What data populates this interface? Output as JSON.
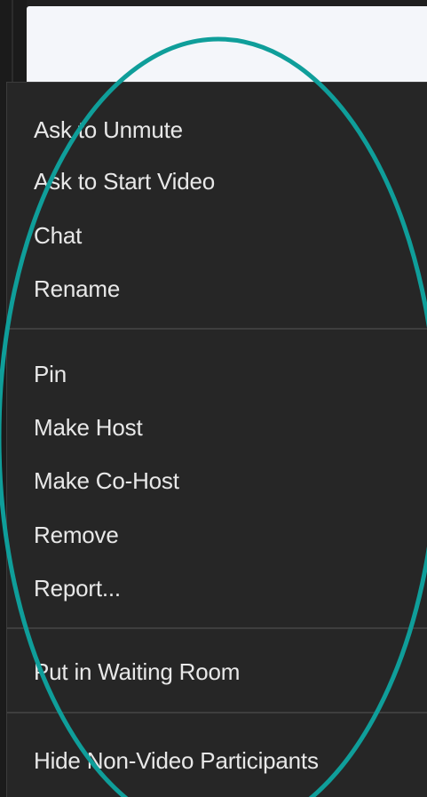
{
  "menu": {
    "groups": [
      {
        "items": [
          {
            "label": "Ask to Unmute"
          },
          {
            "label": "Ask to Start Video"
          },
          {
            "label": "Chat"
          },
          {
            "label": "Rename"
          }
        ]
      },
      {
        "items": [
          {
            "label": "Pin"
          },
          {
            "label": "Make Host"
          },
          {
            "label": "Make Co-Host"
          },
          {
            "label": "Remove"
          },
          {
            "label": "Report..."
          }
        ]
      },
      {
        "items": [
          {
            "label": "Put in Waiting Room"
          }
        ]
      },
      {
        "items": [
          {
            "label": "Hide Non-Video Participants"
          }
        ]
      }
    ]
  },
  "annotation": {
    "shape": "ellipse",
    "color": "#0f9e9a"
  },
  "colors": {
    "menu_background": "#262626",
    "menu_text": "#e8e8e8",
    "separator": "#3e3e3e",
    "video_tile": "#f4f6fa"
  }
}
